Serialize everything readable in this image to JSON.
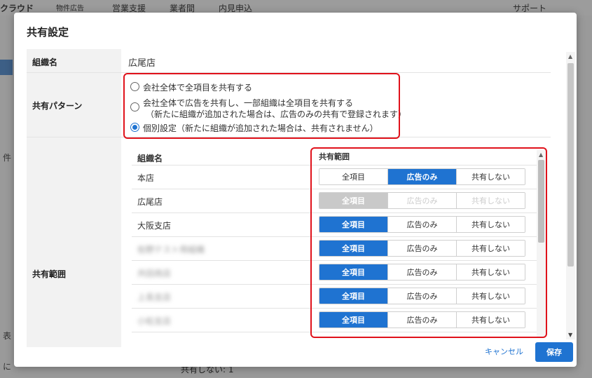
{
  "background": {
    "topbar": {
      "brand": "クラウド",
      "sub": "物件広告",
      "nav1": "営業支援",
      "nav2": "業者間",
      "nav3": "内見申込",
      "support": "サポート"
    },
    "side_text_1": "件",
    "side_text_2": "に",
    "side_text_3": "表",
    "bottom_text": "共有しない: 1"
  },
  "modal": {
    "title": "共有設定",
    "org_label": "組織名",
    "org_value": "広尾店",
    "pattern_label": "共有パターン",
    "pattern_options": [
      {
        "text": "会社全体で全項目を共有する",
        "sub": "",
        "checked": false
      },
      {
        "text": "会社全体で広告を共有し、一部組織は全項目を共有する",
        "sub": "（新たに組織が追加された場合は、広告のみの共有で登録されます）",
        "checked": false
      },
      {
        "text": "個別設定（新たに組織が追加された場合は、共有されません）",
        "sub": "",
        "checked": true
      }
    ],
    "scope_label": "共有範囲",
    "table": {
      "col_org": "組織名",
      "col_scope": "共有範囲",
      "seg_labels": [
        "全項目",
        "広告のみ",
        "共有しない"
      ],
      "rows": [
        {
          "org": "本店",
          "selected": 1,
          "disabled": false,
          "blurred": false
        },
        {
          "org": "広尾店",
          "selected": 0,
          "disabled": true,
          "blurred": false
        },
        {
          "org": "大阪支店",
          "selected": 0,
          "disabled": false,
          "blurred": false
        },
        {
          "org": "佐野テスト用組織",
          "selected": 0,
          "disabled": false,
          "blurred": true
        },
        {
          "org": "共田商店",
          "selected": 0,
          "disabled": false,
          "blurred": true
        },
        {
          "org": "上長支店",
          "selected": 0,
          "disabled": false,
          "blurred": true
        },
        {
          "org": "小松支店",
          "selected": 0,
          "disabled": false,
          "blurred": true
        }
      ]
    },
    "cancel": "キャンセル",
    "save": "保存"
  },
  "colors": {
    "accent": "#1f73d1",
    "highlight": "#e0121b",
    "label_bg": "#f2f2f2"
  }
}
